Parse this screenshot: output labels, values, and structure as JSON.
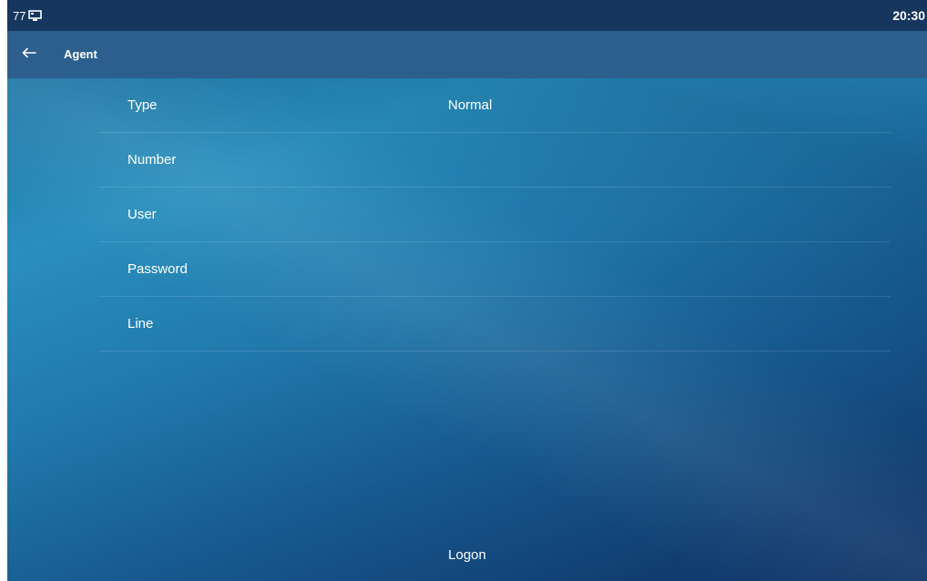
{
  "statusbar": {
    "line_count": "77",
    "time": "20:30"
  },
  "header": {
    "title": "Agent"
  },
  "fields": [
    {
      "label": "Type",
      "value": "Normal"
    },
    {
      "label": "Number",
      "value": ""
    },
    {
      "label": "User",
      "value": ""
    },
    {
      "label": "Password",
      "value": ""
    },
    {
      "label": "Line",
      "value": ""
    }
  ],
  "softkeys": [
    "",
    "",
    "Logon",
    "",
    ""
  ],
  "icons": {
    "status": "monitor-icon",
    "back": "back-arrow-icon"
  },
  "colors": {
    "statusbar_bg": "#17365f",
    "titlebar_bg": "#2c5f8e",
    "background_top": "#2a8fbd",
    "background_bottom": "#0f3566",
    "text": "#ffffff"
  }
}
